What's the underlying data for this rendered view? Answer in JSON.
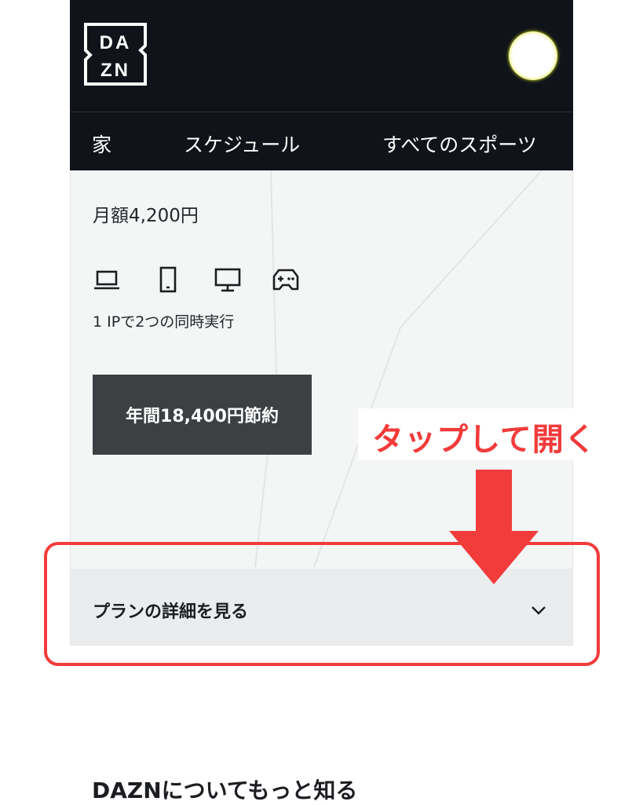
{
  "header": {
    "logo_text": "DAZN"
  },
  "nav": {
    "items": [
      {
        "label": "家"
      },
      {
        "label": "スケジュール"
      },
      {
        "label": "すべてのスポーツ"
      }
    ]
  },
  "plan": {
    "price": "月額4,200円",
    "devices": [
      "laptop-icon",
      "smartphone-icon",
      "tv-icon",
      "gamepad-icon"
    ],
    "simultaneous": "1 IPで2つの同時実行",
    "save_label": "年間18,400円節約",
    "details_label": "プランの詳細を見る"
  },
  "annotation": {
    "callout": "タップして開く",
    "color": "#f23b3b"
  },
  "about": {
    "title": "DAZNについてもっと知る"
  }
}
